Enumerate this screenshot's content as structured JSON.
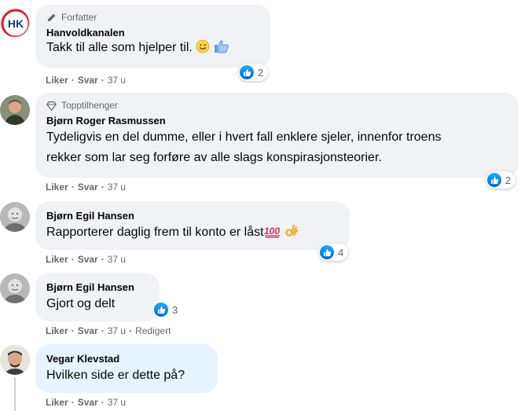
{
  "comments": [
    {
      "badge": "Forfatter",
      "author": "Hanvoldkanalen",
      "text": "Takk til alle som hjelper til.",
      "reaction_count": "2",
      "actions": {
        "like": "Liker",
        "reply": "Svar",
        "time": "37 u"
      }
    },
    {
      "badge": "Topptilhenger",
      "author": "Bjørn Roger Rasmussen",
      "text_line1": "Tydeligvis en del dumme, eller i hvert fall enklere sjeler, innenfor troens",
      "text_line2": "rekker som lar seg forføre av alle slags konspirasjonsteorier.",
      "reaction_count": "2",
      "actions": {
        "like": "Liker",
        "reply": "Svar",
        "time": "37 u"
      }
    },
    {
      "author": "Bjørn Egil Hansen",
      "text": "Rapporterer daglig frem til konto er låst",
      "reaction_count": "4",
      "actions": {
        "like": "Liker",
        "reply": "Svar",
        "time": "37 u"
      }
    },
    {
      "author": "Bjørn Egil Hansen",
      "text": "Gjort og delt",
      "reaction_count": "3",
      "actions": {
        "like": "Liker",
        "reply": "Svar",
        "time": "37 u",
        "edited": "Redigert"
      }
    },
    {
      "author": "Vegar Klevstad",
      "text": "Hvilken side er dette på?",
      "actions": {
        "like": "Liker",
        "reply": "Svar",
        "time": "37 u"
      }
    }
  ],
  "page_avatar_text": "HK",
  "colors": {
    "like_blue": "#1877f2",
    "bubble": "#f0f2f5",
    "highlight_bubble": "#e7f3ff",
    "meta_gray": "#65676b"
  },
  "icons": [
    "pencil-icon",
    "diamond-icon",
    "like-icon",
    "smile-emoji",
    "thumbs-up-emoji",
    "hundred-emoji",
    "ok-hand-emoji"
  ]
}
